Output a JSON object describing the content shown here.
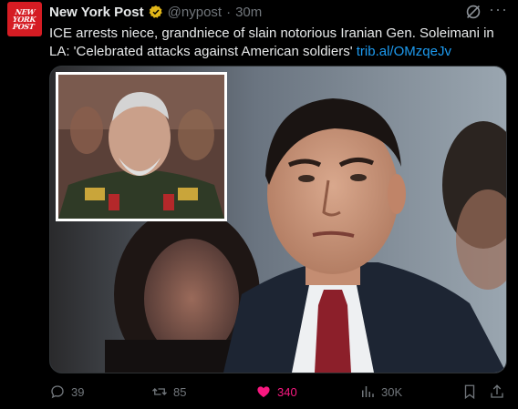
{
  "avatar": {
    "logo_text": "NEW\nYORK\nPOST"
  },
  "header": {
    "name": "New York Post",
    "handle": "@nypost",
    "separator": "·",
    "time": "30m"
  },
  "tweet": {
    "text": "ICE arrests niece, grandniece of slain notorious Iranian Gen. Soleimani in LA: 'Celebrated attacks against American soldiers'",
    "link": "trib.al/OMzqeJv"
  },
  "actions": {
    "replies": "39",
    "reposts": "85",
    "likes": "340",
    "views": "30K"
  },
  "colors": {
    "brand_red": "#d51c23",
    "link_blue": "#1d9bf0",
    "like_pink": "#f91880",
    "verified_gold": "#e2b719"
  },
  "icons": [
    "verified-icon",
    "grok-icon",
    "more-icon",
    "reply-icon",
    "repost-icon",
    "like-icon",
    "views-icon",
    "bookmark-icon",
    "share-icon"
  ]
}
